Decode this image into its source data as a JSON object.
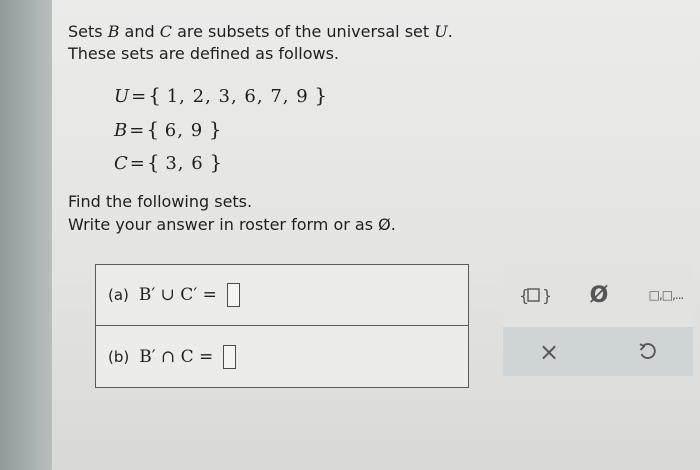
{
  "problem": {
    "line1_a": "Sets ",
    "var_b": "B",
    "line1_b": " and ",
    "var_c": "C",
    "line1_c": " are subsets of the universal set ",
    "var_u": "U",
    "line1_d": ".",
    "line2": "These sets are defined as follows."
  },
  "sets": [
    {
      "name": "U",
      "equals": "=",
      "open": "{",
      "elements": "1, 2, 3, 6, 7, 9",
      "close": "}"
    },
    {
      "name": "B",
      "equals": "=",
      "open": "{",
      "elements": "6, 9",
      "close": "}"
    },
    {
      "name": "C",
      "equals": "=",
      "open": "{",
      "elements": "3, 6",
      "close": "}"
    }
  ],
  "instructions": {
    "line1": "Find the following sets.",
    "line2": "Write your answer in roster form or as Ø."
  },
  "questions": [
    {
      "label": "(a)",
      "expression": "B′ ∪ C′ =",
      "answer": ""
    },
    {
      "label": "(b)",
      "expression": "B′ ∩ C =",
      "answer": ""
    }
  ],
  "keypad": {
    "keys": [
      "set-braces",
      "empty-set",
      "list",
      "clear",
      "undo"
    ],
    "empty_set_glyph": "Ø",
    "clear_glyph": "×",
    "list_glyph": "□,□,..."
  }
}
